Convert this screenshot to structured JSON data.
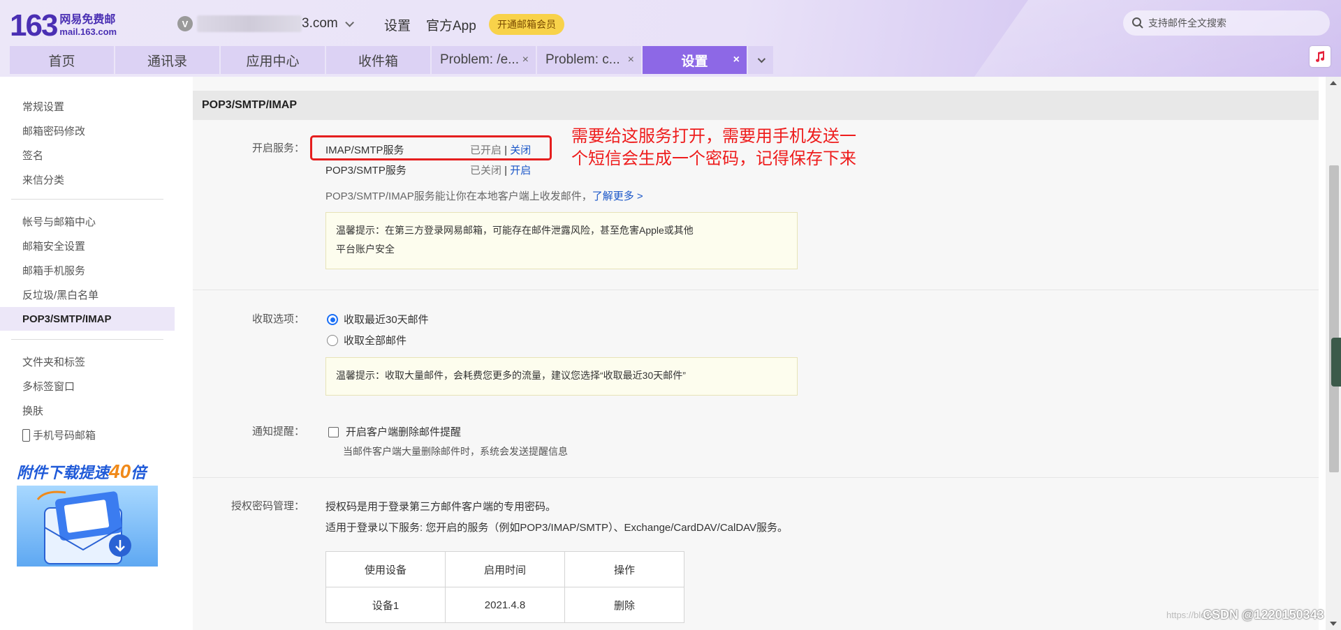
{
  "header": {
    "logo_num": "163",
    "logo_line1": "网易免费邮",
    "logo_line2": "mail.163.com",
    "account_badge": "V",
    "account_suffix": "3.com",
    "nav_settings": "设置",
    "nav_app": "官方App",
    "vip_label": "开通邮箱会员",
    "search_placeholder": "支持邮件全文搜索"
  },
  "tabs": [
    {
      "label": "首页"
    },
    {
      "label": "通讯录"
    },
    {
      "label": "应用中心"
    },
    {
      "label": "收件箱"
    },
    {
      "label": "Problem: /e...",
      "close": "×"
    },
    {
      "label": "Problem: c...",
      "close": "×"
    },
    {
      "label": "设置",
      "close": "×"
    }
  ],
  "sidebar": {
    "group1": [
      "常规设置",
      "邮箱密码修改",
      "签名",
      "来信分类"
    ],
    "group2": [
      "帐号与邮箱中心",
      "邮箱安全设置",
      "邮箱手机服务",
      "反垃圾/黑白名单",
      "POP3/SMTP/IMAP"
    ],
    "group3": [
      "文件夹和标签",
      "多标签窗口",
      "换肤",
      "手机号码邮箱"
    ],
    "banner_title_a": "附件下载提速",
    "banner_title_b": "40",
    "banner_title_c": "倍"
  },
  "main": {
    "title": "POP3/SMTP/IMAP",
    "service_label": "开启服务：",
    "services": [
      {
        "name": "IMAP/SMTP服务",
        "status": "已开启",
        "action": "关闭"
      },
      {
        "name": "POP3/SMTP服务",
        "status": "已关闭",
        "action": "开启"
      }
    ],
    "service_desc": "POP3/SMTP/IMAP服务能让你在本地客户端上收发邮件，",
    "learn_more": "了解更多 >",
    "tip1_line1": "温馨提示：在第三方登录网易邮箱，可能存在邮件泄露风险，甚至危害Apple或其他",
    "tip1_line2": "平台账户安全",
    "annotation_line1": "需要给这服务打开，需要用手机发送一",
    "annotation_line2": "个短信会生成一个密码，记得保存下来",
    "fetch_label": "收取选项：",
    "fetch_options": [
      "收取最近30天邮件",
      "收取全部邮件"
    ],
    "fetch_selected": 0,
    "tip2": "温馨提示：收取大量邮件，会耗费您更多的流量，建议您选择“收取最近30天邮件”",
    "notify_label": "通知提醒：",
    "notify_option": "开启客户端删除邮件提醒",
    "notify_desc": "当邮件客户端大量删除邮件时，系统会发送提醒信息",
    "auth_label": "授权密码管理：",
    "auth_line1": "授权码是用于登录第三方邮件客户端的专用密码。",
    "auth_line2": "适用于登录以下服务: 您开启的服务（例如POP3/IMAP/SMTP）、Exchange/CardDAV/CalDAV服务。",
    "table_headers": [
      "使用设备",
      "启用时间",
      "操作"
    ],
    "table_rows": [
      [
        "设备1",
        "2021.4.8",
        "删除"
      ]
    ]
  },
  "watermark": "https://blog.",
  "watermark2": "CSDN @1220150343"
}
